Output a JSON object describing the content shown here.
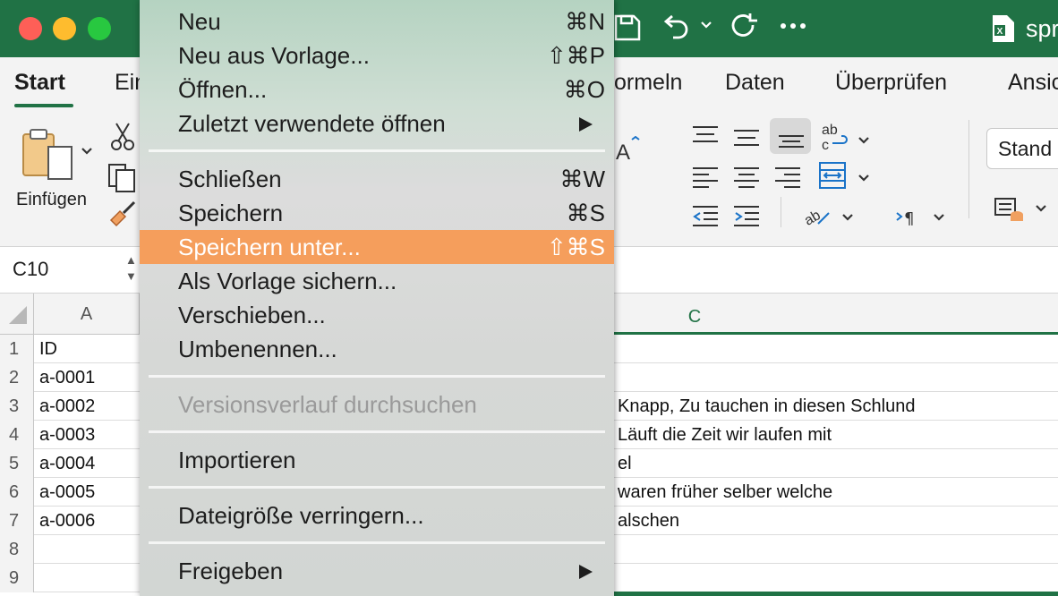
{
  "window": {
    "doc_name": "spr",
    "doc_icon": "excel-file-icon",
    "quick_access": [
      "save-icon",
      "undo-icon",
      "redo-icon",
      "more-icon"
    ]
  },
  "ribbon_tabs": {
    "active": "Start",
    "items": [
      "Start",
      "Ein",
      "ormeln",
      "Daten",
      "Überprüfen",
      "Ansic"
    ]
  },
  "ribbon": {
    "paste_label": "Einfügen",
    "style_box": "Stand"
  },
  "formula_bar": {
    "name_box": "C10"
  },
  "grid": {
    "columns": [
      "A",
      "C"
    ],
    "selected_column": "C",
    "rows": [
      {
        "n": "1",
        "a": "ID",
        "c": ""
      },
      {
        "n": "2",
        "a": "a-0001",
        "c": ""
      },
      {
        "n": "3",
        "a": "a-0002",
        "c": "Knapp, Zu tauchen in diesen Schlund"
      },
      {
        "n": "4",
        "a": "a-0003",
        "c": "Läuft die Zeit wir laufen mit"
      },
      {
        "n": "5",
        "a": "a-0004",
        "c": "el"
      },
      {
        "n": "6",
        "a": "a-0005",
        "c": "waren früher selber welche"
      },
      {
        "n": "7",
        "a": "a-0006",
        "c": "alschen"
      },
      {
        "n": "8",
        "a": "",
        "c": ""
      },
      {
        "n": "9",
        "a": "",
        "c": ""
      }
    ]
  },
  "file_menu": {
    "highlight_color": "#f59e5c",
    "items": {
      "neu": {
        "label": "Neu",
        "shortcut": "⌘N"
      },
      "neu_vorlage": {
        "label": "Neu aus Vorlage...",
        "shortcut": "⇧⌘P"
      },
      "oeffnen": {
        "label": "Öffnen...",
        "shortcut": "⌘O"
      },
      "zuletzt": {
        "label": "Zuletzt verwendete öffnen",
        "shortcut": ""
      },
      "schliessen": {
        "label": "Schließen",
        "shortcut": "⌘W"
      },
      "speichern": {
        "label": "Speichern",
        "shortcut": "⌘S"
      },
      "speichern_unter": {
        "label": "Speichern unter...",
        "shortcut": "⇧⌘S"
      },
      "vorlage": {
        "label": "Als Vorlage sichern...",
        "shortcut": ""
      },
      "verschieben": {
        "label": "Verschieben...",
        "shortcut": ""
      },
      "umbenennen": {
        "label": "Umbenennen...",
        "shortcut": ""
      },
      "versionsverlauf": {
        "label": "Versionsverlauf durchsuchen",
        "shortcut": ""
      },
      "importieren": {
        "label": "Importieren",
        "shortcut": ""
      },
      "dateigroesse": {
        "label": "Dateigröße verringern...",
        "shortcut": ""
      },
      "freigeben": {
        "label": "Freigeben",
        "shortcut": ""
      }
    }
  }
}
